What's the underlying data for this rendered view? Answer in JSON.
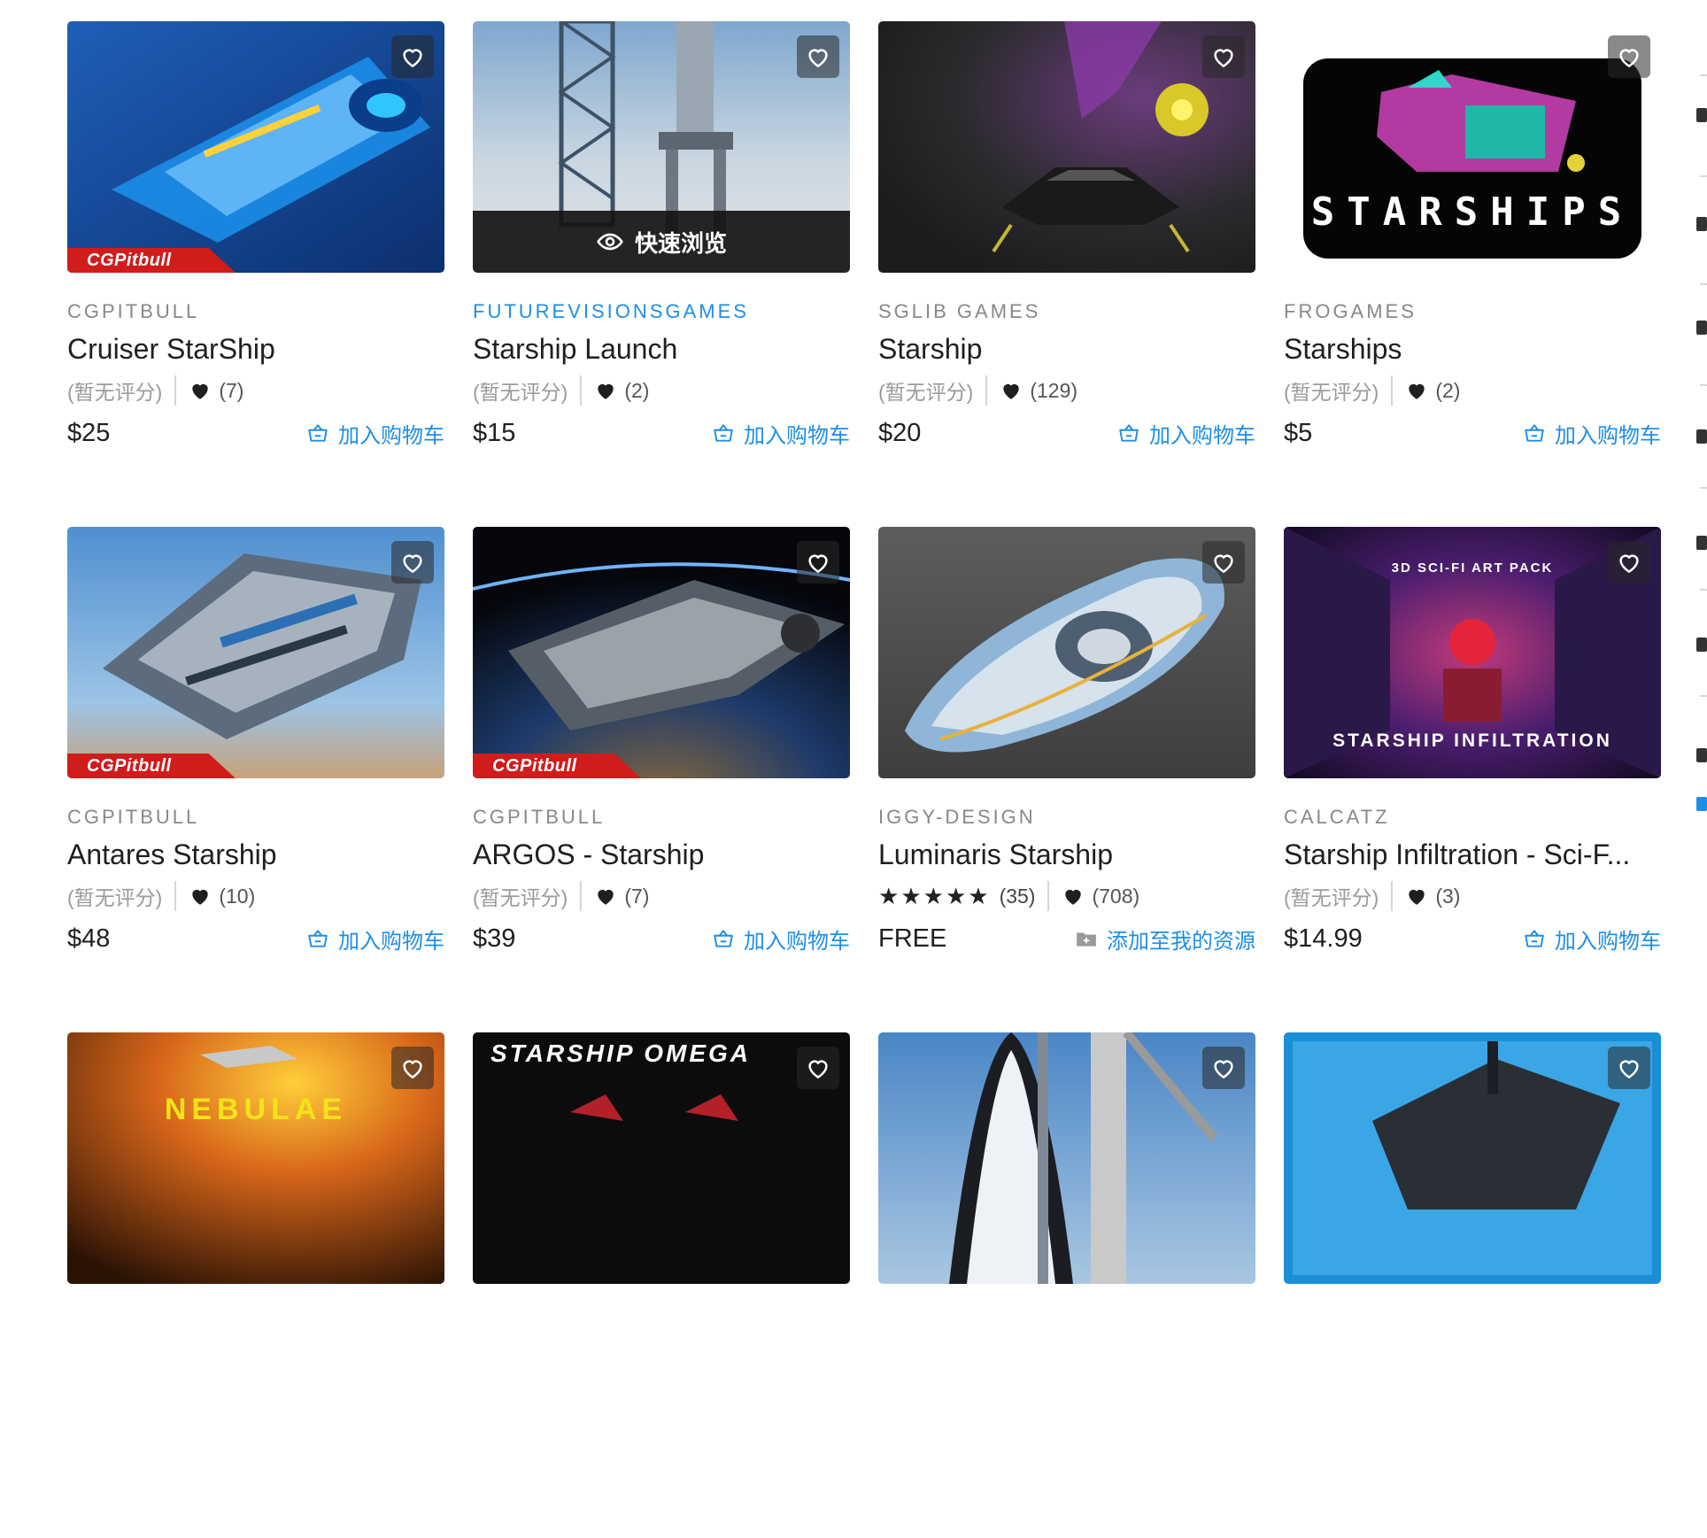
{
  "quick_view_label": "快速浏览",
  "colors": {
    "link": "#1d8ee6",
    "badge": "#d11c1c"
  },
  "products": [
    {
      "publisher": "CGPITBULL",
      "title": "Cruiser StarShip",
      "rating": "(暂无评分)",
      "likes": "(7)",
      "price": "$25",
      "action": "加入购物车",
      "badge": "CGPitbull"
    },
    {
      "publisher": "FUTUREVISIONSGAMES",
      "title": "Starship Launch",
      "rating": "(暂无评分)",
      "likes": "(2)",
      "price": "$15",
      "action": "加入购物车"
    },
    {
      "publisher": "SGLIB GAMES",
      "title": "Starship",
      "rating": "(暂无评分)",
      "likes": "(129)",
      "price": "$20",
      "action": "加入购物车"
    },
    {
      "publisher": "FROGAMES",
      "title": "Starships",
      "rating": "(暂无评分)",
      "likes": "(2)",
      "price": "$5",
      "action": "加入购物车",
      "art_text": "STARSHIPS"
    },
    {
      "publisher": "CGPITBULL",
      "title": "Antares Starship",
      "rating": "(暂无评分)",
      "likes": "(10)",
      "price": "$48",
      "action": "加入购物车",
      "badge": "CGPitbull"
    },
    {
      "publisher": "CGPITBULL",
      "title": "ARGOS - Starship",
      "rating": "(暂无评分)",
      "likes": "(7)",
      "price": "$39",
      "action": "加入购物车",
      "badge": "CGPitbull"
    },
    {
      "publisher": "IGGY-DESIGN",
      "title": "Luminaris Starship",
      "stars": 5,
      "rating_count": "(35)",
      "likes": "(708)",
      "price": "FREE",
      "action": "添加至我的资源"
    },
    {
      "publisher": "CALCATZ",
      "title": "Starship Infiltration - Sci-F...",
      "rating": "(暂无评分)",
      "likes": "(3)",
      "price": "$14.99",
      "action": "加入购物车",
      "art_text_top": "3D SCI-FI ART PACK",
      "art_text_bottom": "STARSHIP INFILTRATION"
    },
    {
      "art_text": "NEBULAE"
    },
    {
      "art_text": "STARSHIP OMEGA"
    },
    {},
    {}
  ]
}
